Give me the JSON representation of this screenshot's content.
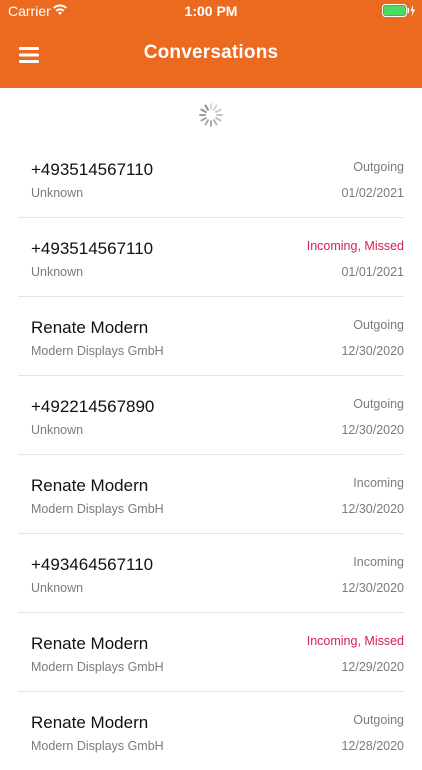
{
  "status_bar": {
    "carrier": "Carrier",
    "time": "1:00 PM"
  },
  "nav": {
    "title": "Conversations"
  },
  "colors": {
    "accent": "#ec6a1f",
    "missed": "#d3224e",
    "secondary_text": "#7b7b7b"
  },
  "icons": {
    "menu": "hamburger-icon",
    "loading": "spinner-icon",
    "wifi": "wifi-icon",
    "battery": "battery-icon"
  },
  "conversations": [
    {
      "name": "+493514567110",
      "company": "Unknown",
      "direction": "Outgoing",
      "missed": false,
      "date": "01/02/2021"
    },
    {
      "name": "+493514567110",
      "company": "Unknown",
      "direction": "Incoming, Missed",
      "missed": true,
      "date": "01/01/2021"
    },
    {
      "name": "Renate Modern",
      "company": "Modern Displays GmbH",
      "direction": "Outgoing",
      "missed": false,
      "date": "12/30/2020"
    },
    {
      "name": "+492214567890",
      "company": "Unknown",
      "direction": "Outgoing",
      "missed": false,
      "date": "12/30/2020"
    },
    {
      "name": "Renate Modern",
      "company": "Modern Displays GmbH",
      "direction": "Incoming",
      "missed": false,
      "date": "12/30/2020"
    },
    {
      "name": "+493464567110",
      "company": "Unknown",
      "direction": "Incoming",
      "missed": false,
      "date": "12/30/2020"
    },
    {
      "name": "Renate Modern",
      "company": "Modern Displays GmbH",
      "direction": "Incoming, Missed",
      "missed": true,
      "date": "12/29/2020"
    },
    {
      "name": "Renate Modern",
      "company": "Modern Displays GmbH",
      "direction": "Outgoing",
      "missed": false,
      "date": "12/28/2020"
    }
  ]
}
